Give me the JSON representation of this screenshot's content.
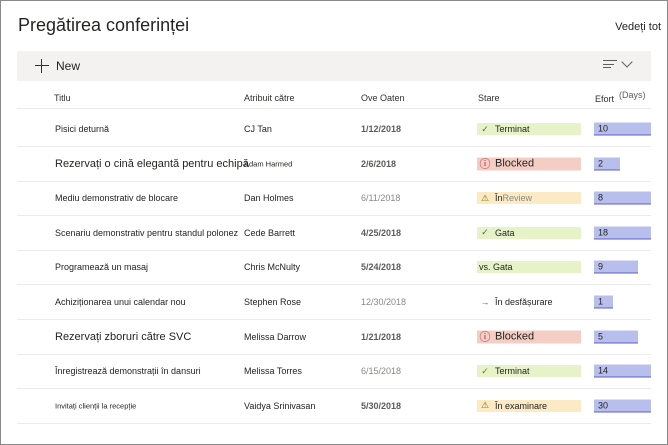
{
  "header": {
    "title": "Pregătirea conferinței",
    "see_all": "Vedeți tot"
  },
  "toolbar": {
    "new_label": "New",
    "sort_icon": "sort-lines-icon",
    "chevron_icon": "chevron-down-icon"
  },
  "columns": {
    "title": "Titlu",
    "assigned": "Atribuit către",
    "due": "Ove Oaten",
    "status": "Stare",
    "effort": "Efort",
    "effort_unit": "(Days)"
  },
  "rows": [
    {
      "title": "Pisici deturnă",
      "assigned": "CJ Tan",
      "due": "1/12/2018",
      "status_text": "Terminat",
      "status_rest": "",
      "status_icon": "✓",
      "status_color": "#e6f3c8",
      "effort": "10",
      "effort_fraction": 0.49
    },
    {
      "title": "Rezervați o cină elegantă pentru echipă",
      "assigned": "Adam Harmed",
      "due": "2/6/2018",
      "status_text": "Blocked",
      "status_rest": "",
      "status_icon": "ⓘ",
      "status_color": "#f4cdc4",
      "effort": "2",
      "effort_fraction": 0.22
    },
    {
      "title": "Mediu demonstrativ de blocare",
      "assigned": "Dan Holmes",
      "due": "6/11/2018",
      "status_text": "În",
      "status_rest": "Review",
      "status_icon": "⚠",
      "status_color": "#fbeac3",
      "effort": "8",
      "effort_fraction": 0.49
    },
    {
      "title": "Scenariu demonstrativ pentru standul polonez",
      "assigned": "Cede Barrett",
      "due": "4/25/2018",
      "status_text": "Gata",
      "status_rest": "",
      "status_icon": "✓",
      "status_color": "#e6f3c8",
      "effort": "18",
      "effort_fraction": 0.49
    },
    {
      "title": "Programează un masaj",
      "assigned": "Chris McNulty",
      "due": "5/24/2018",
      "status_text": "vs. Gata",
      "status_rest": "",
      "status_icon": "",
      "status_color": "#e6f3c8",
      "effort": "9",
      "effort_fraction": 0.38
    },
    {
      "title": "Achiziționarea unui calendar nou",
      "assigned": "Stephen Rose",
      "due": "12/30/2018",
      "status_text": "În desfășurare",
      "status_rest": "",
      "status_icon": "→",
      "status_color": "",
      "effort": "1",
      "effort_fraction": 0.16
    },
    {
      "title": "Rezervați zboruri către SVC",
      "assigned": "Melissa Darrow",
      "due": "1/21/2018",
      "status_text": "Blocked",
      "status_rest": "",
      "status_icon": "ⓘ",
      "status_color": "#f4cdc4",
      "effort": "5",
      "effort_fraction": 0.38
    },
    {
      "title": "Înregistrează demonstrații în dansuri",
      "assigned": "Melissa Torres",
      "due": "6/15/2018",
      "status_text": "Terminat",
      "status_rest": "",
      "status_icon": "✓",
      "status_color": "#e6f3c8",
      "effort": "14",
      "effort_fraction": 0.49
    },
    {
      "title": "Invitați clienții la recepție",
      "assigned": "Vaidya Srinivasan",
      "due": "5/30/2018",
      "status_text": "În examinare",
      "status_rest": "",
      "status_icon": "⚠",
      "status_color": "#fbeac3",
      "effort": "30",
      "effort_fraction": 0.49
    }
  ]
}
